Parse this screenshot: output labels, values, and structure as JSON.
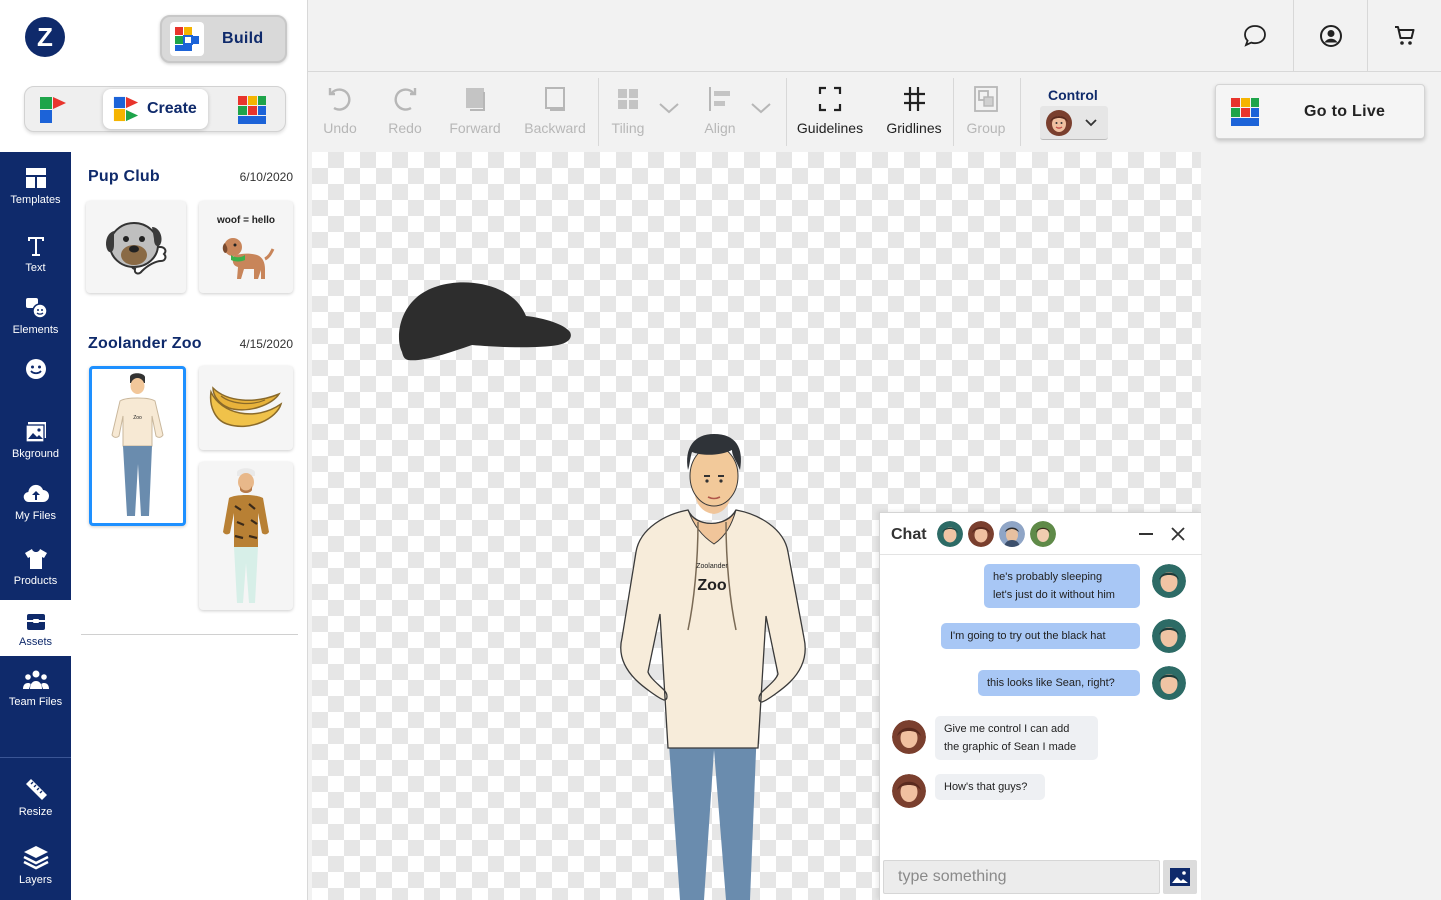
{
  "header": {
    "logo_letter": "Z",
    "build_label": "Build",
    "icons": [
      "chat-bubble-icon",
      "account-icon",
      "cart-icon"
    ]
  },
  "mode": {
    "create_label": "Create"
  },
  "rail": {
    "items": [
      {
        "label": "Templates",
        "icon": "templates-icon"
      },
      {
        "label": "Text",
        "icon": "text-icon"
      },
      {
        "label": "Elements",
        "icon": "elements-icon"
      },
      {
        "label": "",
        "icon": "emoji-icon"
      },
      {
        "label": "Bkground",
        "icon": "background-icon"
      },
      {
        "label": "My Files",
        "icon": "upload-cloud-icon"
      },
      {
        "label": "Products",
        "icon": "tshirt-icon"
      },
      {
        "label": "Assets",
        "icon": "box-icon"
      },
      {
        "label": "Team Files",
        "icon": "team-icon"
      },
      {
        "label": "Resize",
        "icon": "ruler-icon"
      },
      {
        "label": "Layers",
        "icon": "layers-icon"
      }
    ]
  },
  "assets": {
    "sections": [
      {
        "title": "Pup Club",
        "date": "6/10/2020",
        "thumb_caption": "woof = hello"
      },
      {
        "title": "Zoolander Zoo",
        "date": "4/15/2020"
      }
    ]
  },
  "toolbar": {
    "tools": [
      {
        "label": "Undo",
        "enabled": false
      },
      {
        "label": "Redo",
        "enabled": false
      },
      {
        "label": "Forward",
        "enabled": false
      },
      {
        "label": "Backward",
        "enabled": false
      },
      {
        "label": "Tiling",
        "enabled": false
      },
      {
        "label": "Align",
        "enabled": false
      },
      {
        "label": "Guidelines",
        "enabled": true
      },
      {
        "label": "Gridlines",
        "enabled": true
      },
      {
        "label": "Group",
        "enabled": false
      }
    ],
    "control_label": "Control"
  },
  "canvas": {
    "hoodie_small": "Zoolander",
    "hoodie_big": "Zoo"
  },
  "golive": {
    "label": "Go to Live"
  },
  "chat": {
    "title": "Chat",
    "messages": [
      {
        "from": "me",
        "lines": [
          "he's probably sleeping",
          "let's just do it without him"
        ]
      },
      {
        "from": "me",
        "lines": [
          "I'm going to try out the black hat"
        ]
      },
      {
        "from": "me",
        "lines": [
          "this looks like Sean, right?"
        ]
      },
      {
        "from": "other",
        "lines": [
          "Give me control I can add",
          "the graphic of Sean I made"
        ]
      },
      {
        "from": "other",
        "lines": [
          "How's that guys?"
        ]
      }
    ],
    "input_placeholder": "type something"
  },
  "colors": {
    "brand_navy": "#0f2a6b",
    "selection_blue": "#1e90ff",
    "outgoing_bubble": "#a8c7f5"
  }
}
